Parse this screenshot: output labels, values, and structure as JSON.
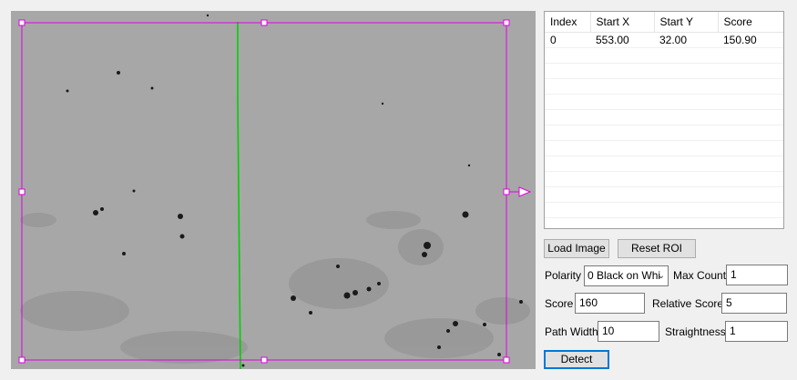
{
  "table": {
    "columns": [
      "Index",
      "Start X",
      "Start Y",
      "Score"
    ],
    "rows": [
      {
        "index": "0",
        "start_x": "553.00",
        "start_y": "32.00",
        "score": "150.90"
      }
    ]
  },
  "buttons": {
    "load_image": "Load Image",
    "reset_roi": "Reset ROI",
    "detect": "Detect"
  },
  "params": {
    "polarity_label": "Polarity",
    "polarity_value": "0 Black on Whi",
    "max_count_label": "Max Count",
    "max_count_value": "1",
    "score_label": "Score",
    "score_value": "160",
    "relative_score_label": "Relative Score",
    "relative_score_value": "5",
    "path_width_label": "Path Width",
    "path_width_value": "10",
    "straightness_label": "Straightness",
    "straightness_value": "1"
  },
  "colors": {
    "roi": "#e000e0",
    "detected_line": "#00d000",
    "image_background": "#a7a7a7"
  },
  "icons": {
    "select_arrow": "chevron-down-icon",
    "direction_arrow": "arrow-right-icon"
  }
}
